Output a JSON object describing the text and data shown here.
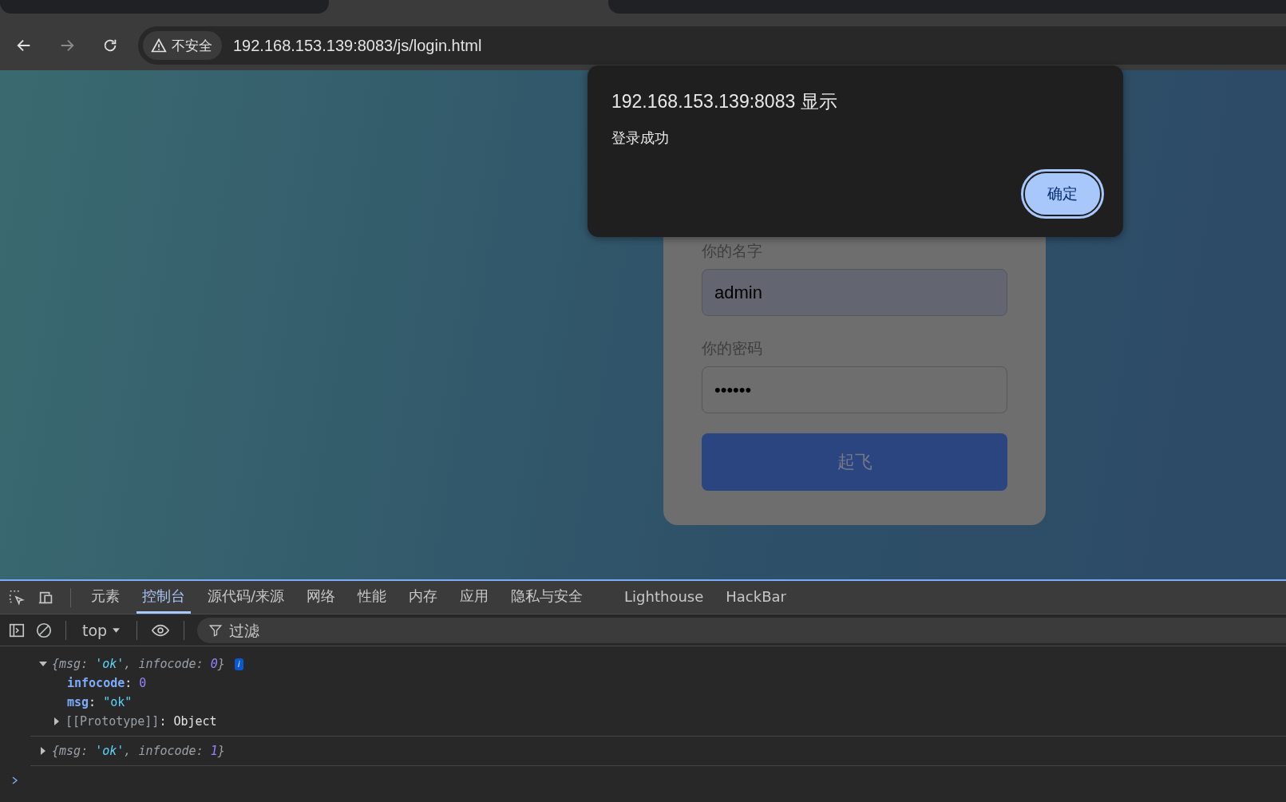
{
  "address_bar": {
    "security_label": "不安全",
    "url": "192.168.153.139:8083/js/login.html"
  },
  "login_form": {
    "fields": [
      {
        "label": "你的名字",
        "value": "admin"
      },
      {
        "label": "你的密码",
        "value": "••••••"
      }
    ],
    "submit": "起飞"
  },
  "alert": {
    "title": "192.168.153.139:8083 显示",
    "message": "登录成功",
    "button": "确定"
  },
  "devtools": {
    "tabs": [
      {
        "label": "元素",
        "selected": false
      },
      {
        "label": "控制台",
        "selected": true
      },
      {
        "label": "源代码/来源",
        "selected": false
      },
      {
        "label": "网络",
        "selected": false
      },
      {
        "label": "性能",
        "selected": false
      },
      {
        "label": "内存",
        "selected": false
      },
      {
        "label": "应用",
        "selected": false
      },
      {
        "label": "隐私与安全",
        "selected": false
      },
      {
        "label": "Lighthouse",
        "selected": false
      },
      {
        "label": "HackBar",
        "selected": false
      }
    ],
    "context": "top",
    "filter_placeholder": "过滤",
    "console": [
      {
        "expanded": true,
        "summary": [
          {
            "kind": "punct",
            "text": "{"
          },
          {
            "kind": "key",
            "text": "msg"
          },
          {
            "kind": "punct",
            "text": ": "
          },
          {
            "kind": "str",
            "text": "'ok'"
          },
          {
            "kind": "punct",
            "text": ", "
          },
          {
            "kind": "key",
            "text": "infocode"
          },
          {
            "kind": "punct",
            "text": ": "
          },
          {
            "kind": "num",
            "text": "0"
          },
          {
            "kind": "punct",
            "text": "}"
          }
        ],
        "info_badge": "i",
        "children": [
          {
            "kind": "prop",
            "tokens": [
              {
                "kind": "pkey",
                "text": "infocode"
              },
              {
                "kind": "punct2",
                "text": ": "
              },
              {
                "kind": "num",
                "text": "0"
              }
            ]
          },
          {
            "kind": "prop",
            "tokens": [
              {
                "kind": "pkey",
                "text": "msg"
              },
              {
                "kind": "punct2",
                "text": ": "
              },
              {
                "kind": "str",
                "text": "\"ok\""
              }
            ]
          },
          {
            "kind": "proto",
            "tokens": [
              {
                "kind": "punct",
                "text": "[[Prototype]]"
              },
              {
                "kind": "punct2",
                "text": ": "
              },
              {
                "kind": "plain",
                "text": "Object"
              }
            ]
          }
        ]
      },
      {
        "expanded": false,
        "summary": [
          {
            "kind": "punct",
            "text": "{"
          },
          {
            "kind": "key",
            "text": "msg"
          },
          {
            "kind": "punct",
            "text": ": "
          },
          {
            "kind": "str",
            "text": "'ok'"
          },
          {
            "kind": "punct",
            "text": ", "
          },
          {
            "kind": "key",
            "text": "infocode"
          },
          {
            "kind": "punct",
            "text": ": "
          },
          {
            "kind": "num",
            "text": "1"
          },
          {
            "kind": "punct",
            "text": "}"
          }
        ]
      }
    ]
  }
}
